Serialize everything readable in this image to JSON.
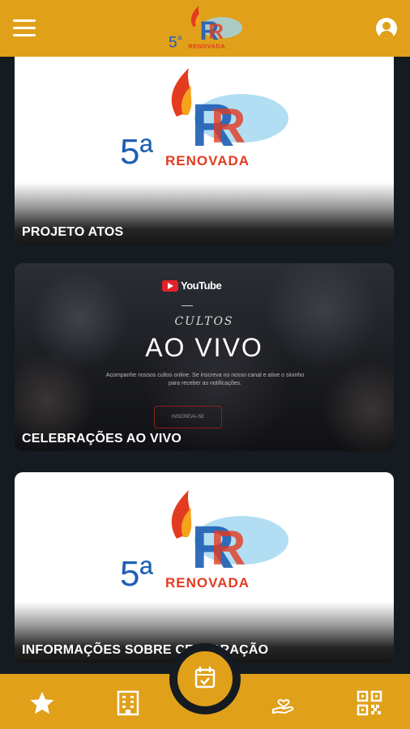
{
  "header": {
    "menu_icon": "hamburger-menu-icon",
    "logo": "5a-renovada-logo",
    "account_icon": "account-circle-icon"
  },
  "cards": [
    {
      "title": "PROJETO ATOS",
      "logo_number": "5ª",
      "logo_word": "RENOVADA"
    },
    {
      "title": "CELEBRAÇÕES AO VIVO",
      "banner": {
        "brand": "YouTube",
        "overline": "CULTOS",
        "headline": "AO VIVO",
        "description": "Acompanhe nossos cultos online. Se inscreva no nosso canal e ative o sininho para receber as notificações.",
        "button": "INSCREVA-SE"
      }
    },
    {
      "title": "INFORMAÇÕES SOBRE CELEBRAÇÃO",
      "logo_number": "5ª",
      "logo_word": "RENOVADA"
    }
  ],
  "bottom_nav": {
    "items": [
      "star-icon",
      "building-icon",
      "calendar-check-icon",
      "hand-heart-icon",
      "qr-code-icon"
    ],
    "active": "calendar-check-icon"
  },
  "colors": {
    "accent": "#e0a019",
    "background": "#151b20"
  }
}
